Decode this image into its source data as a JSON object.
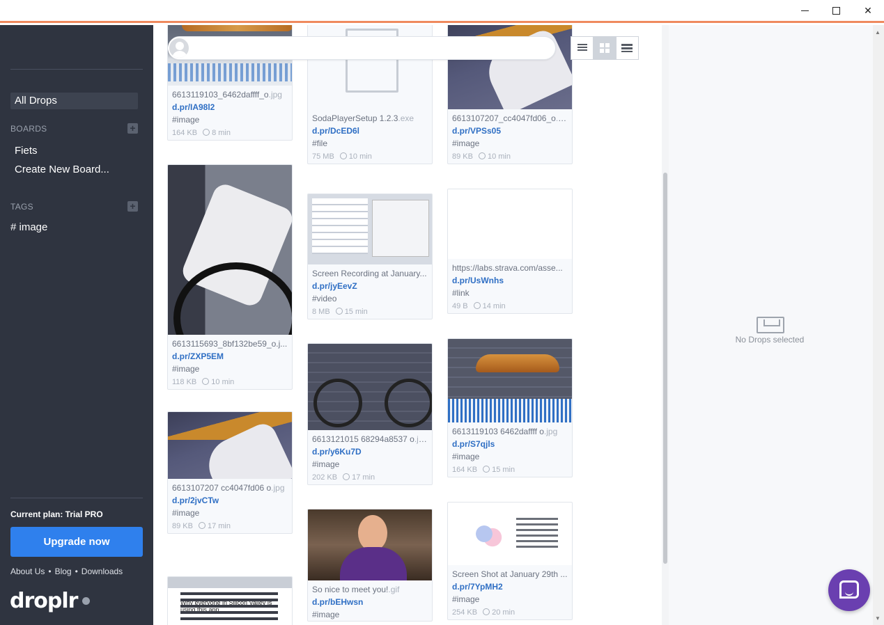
{
  "window": {
    "min_glyph": "—",
    "max_glyph": "☐",
    "close_glyph": "✕"
  },
  "sidebar": {
    "all_drops": "All Drops",
    "boards_heading": "BOARDS",
    "boards_add": "+",
    "boards": [
      "Fiets",
      "Create New Board..."
    ],
    "tags_heading": "TAGS",
    "tags_add": "+",
    "tags": [
      "# image"
    ],
    "plan": "Current plan: Trial PRO",
    "upgrade": "Upgrade now",
    "footer": [
      "About Us",
      "Blog",
      "Downloads"
    ],
    "footer_sep": "•",
    "logo": "droplr"
  },
  "toolbar": {
    "view_modes": [
      "list",
      "grid",
      "rows"
    ],
    "active_view": "grid"
  },
  "drops": [
    {
      "name": "6613119103_6462daffff_o",
      "ext": ".jpg",
      "link": "d.pr/IA98l2",
      "tag": "#image",
      "size": "164 KB",
      "age": "8 min"
    },
    {
      "name": "SodaPlayerSetup 1.2.3",
      "ext": ".exe",
      "link": "d.pr/DcED6l",
      "tag": "#file",
      "size": "75 MB",
      "age": "10 min"
    },
    {
      "name": "6613107207_cc4047fd06_o",
      "ext": ".jpg",
      "link": "d.pr/VPSs05",
      "tag": "#image",
      "size": "89 KB",
      "age": "10 min"
    },
    {
      "name": "6613115693_8bf132be59_o.j...",
      "ext": "",
      "link": "d.pr/ZXP5EM",
      "tag": "#image",
      "size": "118 KB",
      "age": "10 min"
    },
    {
      "name": "Screen Recording at January...",
      "ext": "",
      "link": "d.pr/jyEevZ",
      "tag": "#video",
      "size": "8 MB",
      "age": "15 min"
    },
    {
      "name": "https://labs.strava.com/asse...",
      "ext": "",
      "link": "d.pr/UsWnhs",
      "tag": "#link",
      "size": "49 B",
      "age": "14 min"
    },
    {
      "name": "6613121015 68294a8537 o",
      "ext": ".jpg",
      "link": "d.pr/y6Ku7D",
      "tag": "#image",
      "size": "202 KB",
      "age": "17 min"
    },
    {
      "name": "6613119103 6462daffff o",
      "ext": ".jpg",
      "link": "d.pr/S7qjls",
      "tag": "#image",
      "size": "164 KB",
      "age": "15 min"
    },
    {
      "name": "6613107207 cc4047fd06 o",
      "ext": ".jpg",
      "link": "d.pr/2jvCTw",
      "tag": "#image",
      "size": "89 KB",
      "age": "17 min"
    },
    {
      "name": "So nice to meet you!",
      "ext": ".gif",
      "link": "d.pr/bEHwsn",
      "tag": "#image",
      "size": "",
      "age": ""
    },
    {
      "name": "Screen Shot at January 29th ...",
      "ext": "",
      "link": "d.pr/7YpMH2",
      "tag": "#image",
      "size": "254 KB",
      "age": "20 min"
    },
    {
      "name": "",
      "ext": "",
      "link": "",
      "tag": "",
      "size": "",
      "age": "",
      "thumb_text": "Why everyone in Silicon Valley is using this app"
    }
  ],
  "detail": {
    "empty_text": "No Drops selected"
  },
  "colors": {
    "accent": "#ef8a5e",
    "sidebar_bg": "#2f3440",
    "upgrade_bg": "#2f80ed",
    "link": "#2f6fc4",
    "chat": "#6a3fb0"
  }
}
